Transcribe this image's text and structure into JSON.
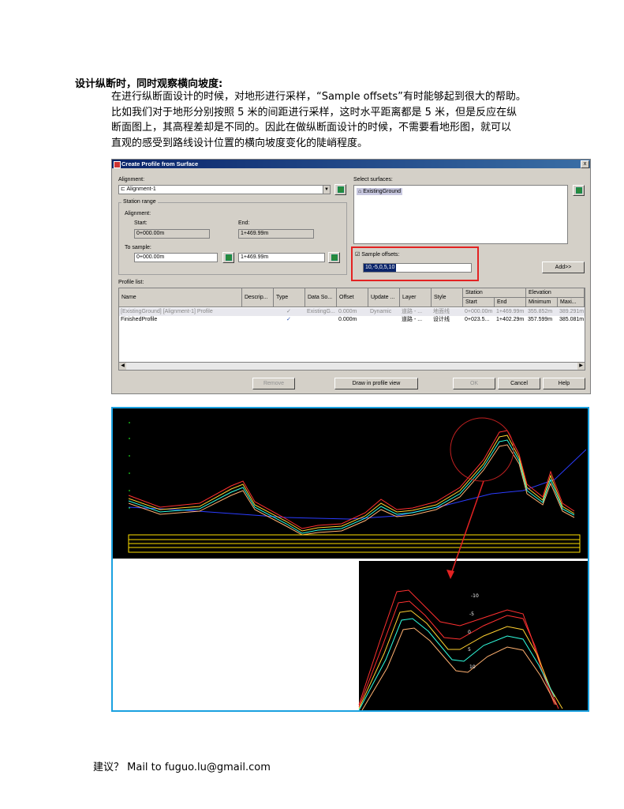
{
  "heading": "设计纵断时，同时观察横向坡度:",
  "paragraph_lines": [
    "在进行纵断面设计的时候，对地形进行采样，“Sample  offsets”有时能够起到很大的帮助。",
    "比如我们对于地形分别按照 5 米的间距进行采样，这时水平距离都是 5 米，但是反应在纵",
    "断面图上，其高程差却是不同的。因此在做纵断面设计的时候，不需要看地形图，就可以",
    "直观的感受到路线设计位置的横向坡度变化的陡峭程度。"
  ],
  "dialog": {
    "title": "Create Profile from Surface",
    "close": "x",
    "alignment_label": "Alignment:",
    "alignment_value": "Alignment-1",
    "station_range_label": "Station range",
    "alignment_sub_label": "Alignment:",
    "start_label": "Start:",
    "start_value": "0+000.00m",
    "end_label": "End:",
    "end_value": "1+469.99m",
    "to_sample_label": "To sample:",
    "sample_start": "0+000.00m",
    "sample_end": "1+469.99m",
    "select_surfaces_label": "Select surfaces:",
    "surface_item": "ExistingGround",
    "sample_offsets_label": "Sample offsets:",
    "sample_offsets_value": "10,-5,0,5,10",
    "add_button": "Add>>",
    "profile_list_label": "Profile list:",
    "columns": {
      "name": "Name",
      "description": "Descrip...",
      "type": "Type",
      "data_source": "Data So...",
      "offset": "Offset",
      "update": "Update ...",
      "layer": "Layer",
      "style": "Style",
      "station": "Station",
      "station_start": "Start",
      "station_end": "End",
      "elevation": "Elevation",
      "elev_min": "Minimum",
      "elev_max": "Maxi..."
    },
    "rows": [
      {
        "name": "[ExistingGround] [Alignment-1] Profile",
        "type": "✓",
        "data_source": "ExistingG...",
        "offset": "0.000m",
        "update": "Dynamic",
        "layer": "道路 - ...",
        "style": "地面线",
        "start": "0+000.00m",
        "end": "1+469.99m",
        "min": "355.852m",
        "max": "389.291m"
      },
      {
        "name": "FinishedProfile",
        "type": "✓",
        "data_source": "",
        "offset": "0.000m",
        "update": "",
        "layer": "道路 - ...",
        "style": "设计线",
        "start": "0+023.5...",
        "end": "1+402.29m",
        "min": "357.599m",
        "max": "385.081m"
      }
    ],
    "remove_button": "Remove",
    "draw_button": "Draw in profile view",
    "ok_button": "OK",
    "cancel_button": "Cancel",
    "help_button": "Help"
  },
  "zoom_labels": [
    "-10",
    "-5",
    "0",
    "5",
    "10"
  ],
  "colors": {
    "red_highlight": "#e32222",
    "panel_border": "#1aa1e0"
  },
  "footer": "建议？ Mail to fuguo.lu@gmail.com"
}
